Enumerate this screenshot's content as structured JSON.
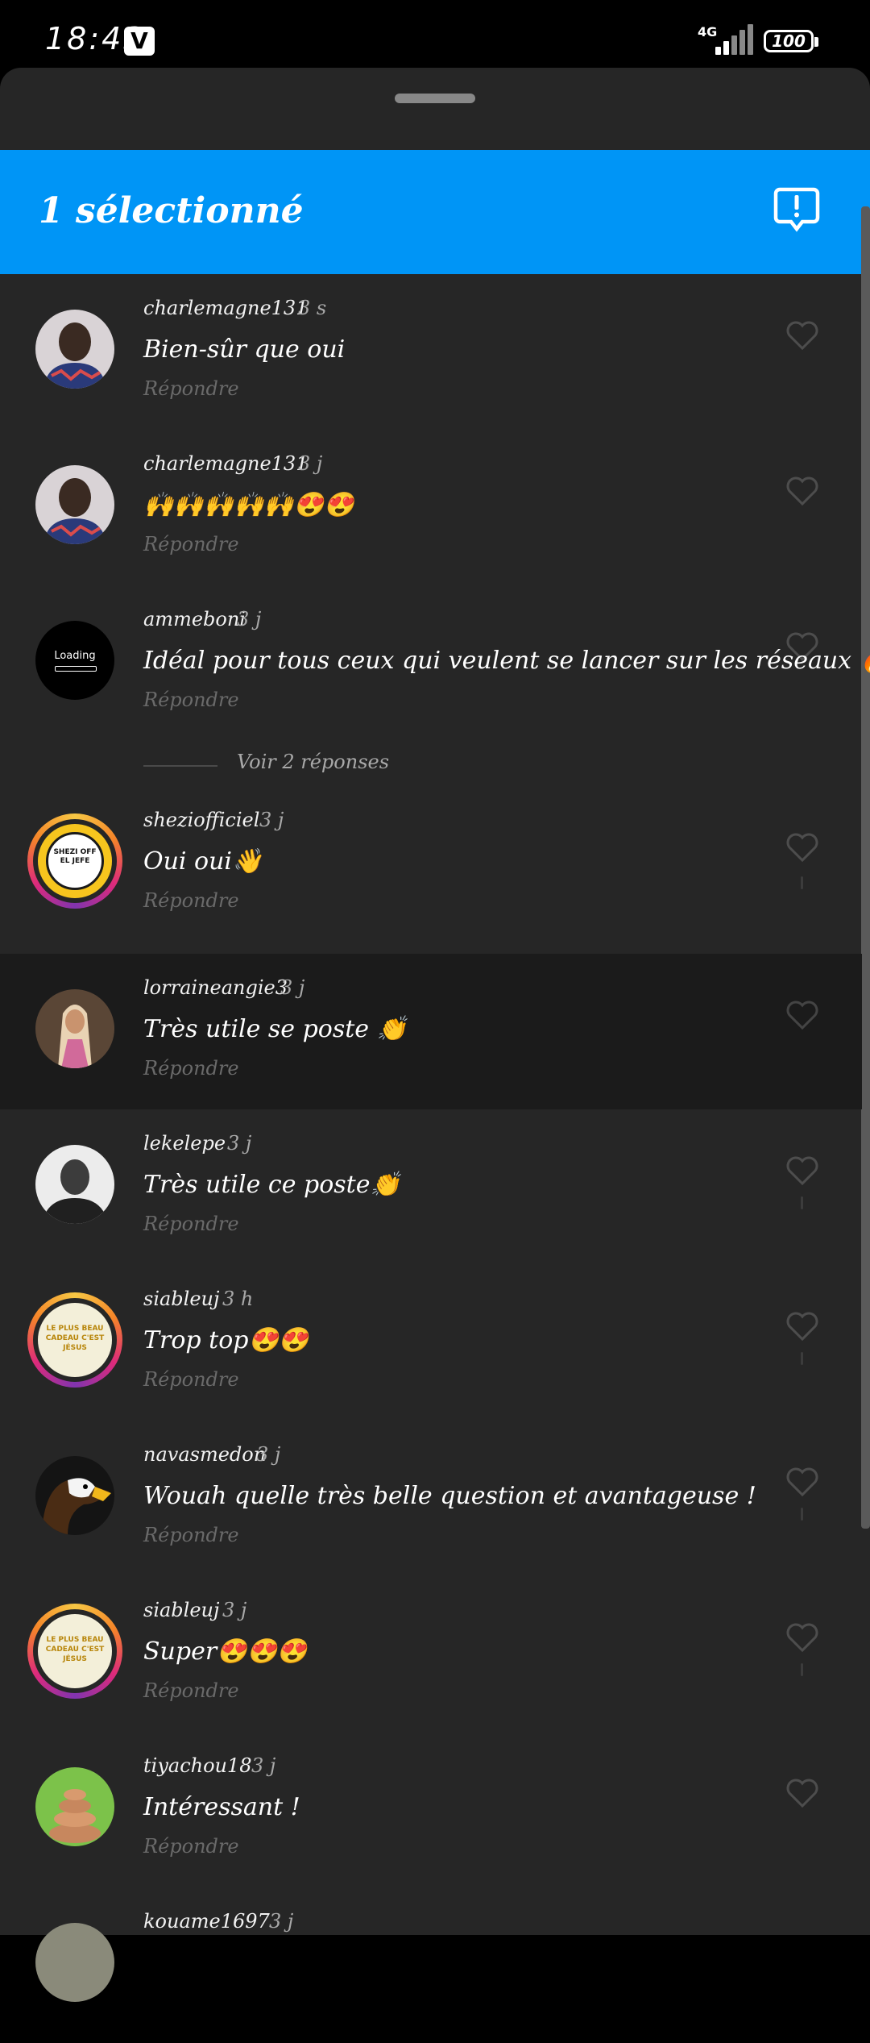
{
  "status": {
    "time": "18:43",
    "app_badge": "V",
    "network": "4G",
    "battery": "100"
  },
  "header": {
    "selected_label": "1 sélectionné"
  },
  "comments": [
    {
      "username": "charlemagne131",
      "time": "3 s",
      "text": "Bien-sûr que oui",
      "reply": "Répondre",
      "avatar": "photo-man-dark-shirt"
    },
    {
      "username": "charlemagne131",
      "time": "3 j",
      "text": "🙌🙌🙌🙌🙌😍😍",
      "reply": "Répondre",
      "avatar": "photo-man-dark-shirt"
    },
    {
      "username": "ammeboni",
      "time": "3 j",
      "text": "Idéal pour tous ceux qui veulent se lancer sur les réseaux 🔥",
      "reply": "Répondre",
      "avatar": "loading-avatar",
      "avatar_text": "Loading"
    },
    {
      "username": "sheziofficiel",
      "time": "3 j",
      "text": "Oui oui👋",
      "reply": "Répondre",
      "avatar": "shezi-logo",
      "avatar_text": "SHEZI OFF EL JEFE"
    },
    {
      "username": "lorraineangie3",
      "time": "3 j",
      "text": "Très utile se poste 👏",
      "reply": "Répondre",
      "avatar": "photo-woman",
      "selected": true
    },
    {
      "username": "lekelepe",
      "time": "3 j",
      "text": "Très utile ce poste👏",
      "reply": "Répondre",
      "avatar": "photo-man-bw"
    },
    {
      "username": "siableuj",
      "time": "3 h",
      "text": "Trop top😍😍",
      "reply": "Répondre",
      "avatar": "cadeau-poster",
      "avatar_text": "LE PLUS BEAU CADEAU C'EST JÉSUS"
    },
    {
      "username": "navasmedon",
      "time": "3 j",
      "text": "Wouah quelle très belle question et avantageuse !",
      "reply": "Répondre",
      "avatar": "eagle-photo"
    },
    {
      "username": "siableuj",
      "time": "3 j",
      "text": "Super😍😍😍",
      "reply": "Répondre",
      "avatar": "cadeau-poster",
      "avatar_text": "LE PLUS BEAU CADEAU C'EST JÉSUS"
    },
    {
      "username": "tiyachou18",
      "time": "3 j",
      "text": "Intéressant !",
      "reply": "Répondre",
      "avatar": "stones-photo"
    },
    {
      "username": "kouame1697",
      "time": "3 j",
      "text": "",
      "reply": "",
      "avatar": "photo-partial"
    }
  ],
  "replies_toggle": "Voir 2 réponses",
  "colors": {
    "accent": "#0095f6",
    "sheet_bg": "#262626",
    "selected_row": "#1b1b1b"
  }
}
